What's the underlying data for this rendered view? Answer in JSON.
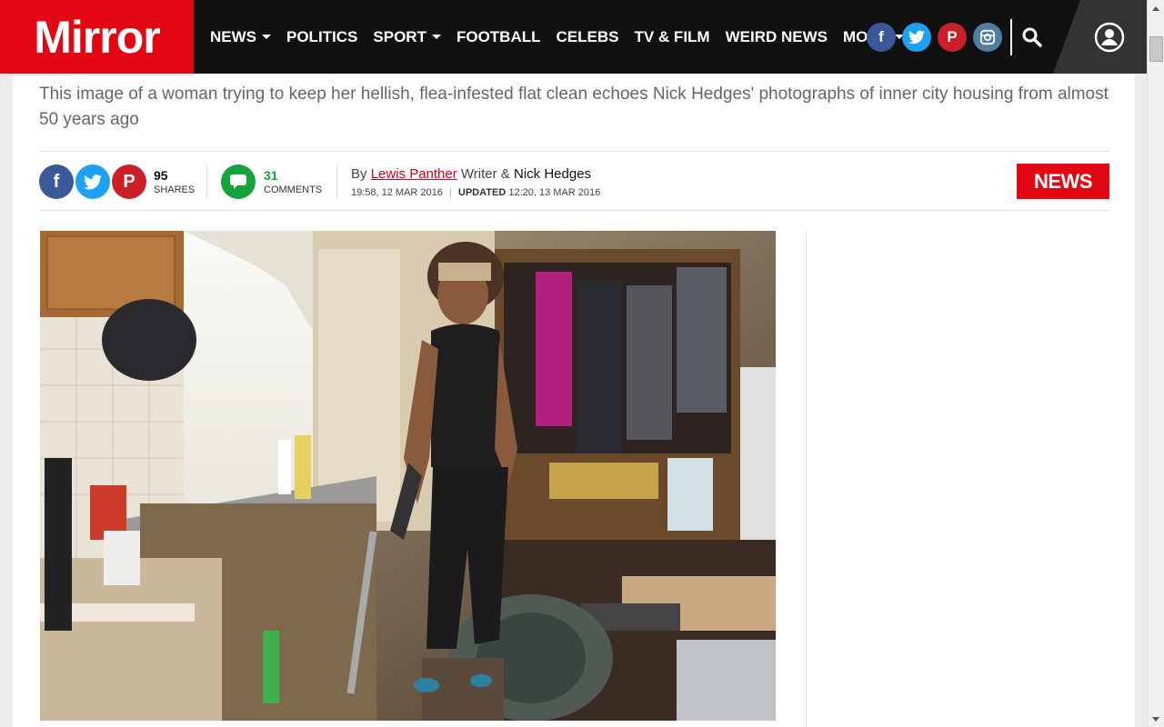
{
  "header": {
    "logo": "Mirror",
    "nav": [
      {
        "label": "NEWS",
        "dropdown": true
      },
      {
        "label": "POLITICS",
        "dropdown": false
      },
      {
        "label": "SPORT",
        "dropdown": true
      },
      {
        "label": "FOOTBALL",
        "dropdown": false
      },
      {
        "label": "CELEBS",
        "dropdown": false
      },
      {
        "label": "TV & FILM",
        "dropdown": false
      },
      {
        "label": "WEIRD NEWS",
        "dropdown": false
      },
      {
        "label": "MORE",
        "dropdown": true
      }
    ],
    "social": [
      {
        "name": "facebook-icon",
        "glyph": "f",
        "color": "#3b5998"
      },
      {
        "name": "twitter-icon",
        "glyph": "t",
        "color": "#1da1f2"
      },
      {
        "name": "pinterest-icon",
        "glyph": "P",
        "color": "#cb2027"
      },
      {
        "name": "instagram-icon",
        "glyph": "◎",
        "color": "#517fa4"
      }
    ],
    "colors": {
      "brand": "#e30613",
      "bar": "#111111"
    }
  },
  "article": {
    "standfirst": "This image of a woman trying to keep her hellish, flea-infested flat clean echoes Nick Hedges' photographs of inner city housing from almost 50 years ago",
    "shares": {
      "count": "95",
      "label": "SHARES"
    },
    "comments": {
      "count": "31",
      "label": "COMMENTS"
    },
    "byline": {
      "by": "By",
      "author1": "Lewis Panther",
      "role": "Writer &",
      "author2": "Nick Hedges"
    },
    "published": "19:58, 12 MAR 2016",
    "updated_label": "UPDATED",
    "updated": "12:20, 13 MAR 2016",
    "section_badge": "NEWS"
  }
}
